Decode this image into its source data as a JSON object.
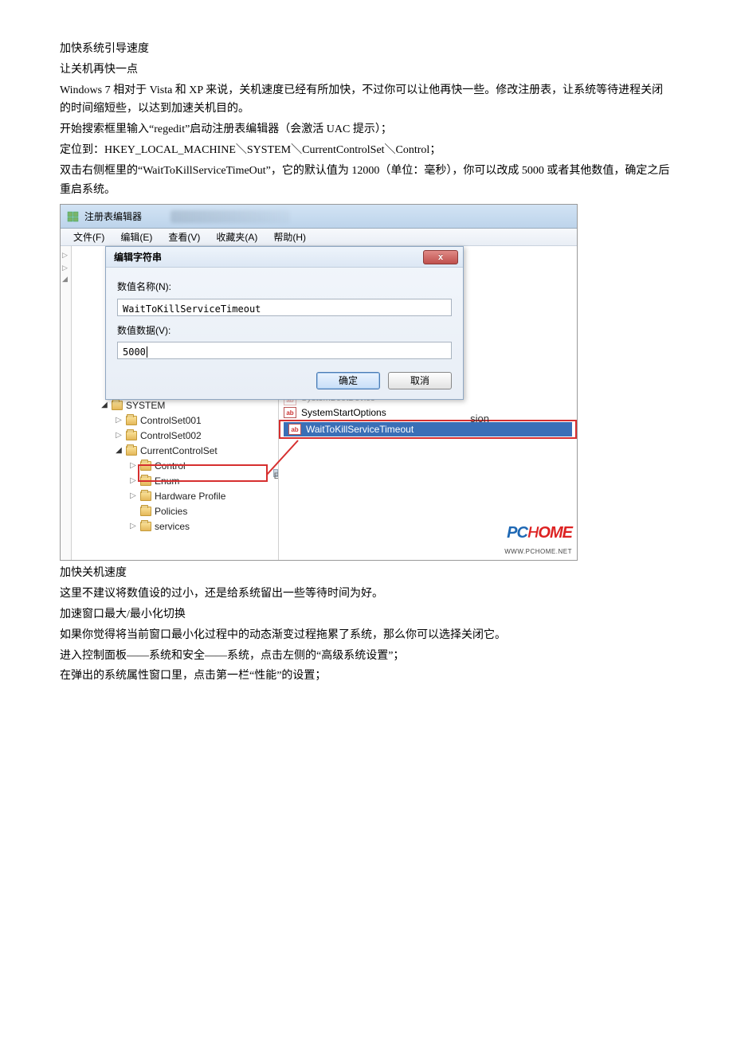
{
  "article": {
    "p1": "加快系统引导速度",
    "p2": "让关机再快一点",
    "p3": "Windows 7 相对于 Vista 和 XP 来说，关机速度已经有所加快，不过你可以让他再快一些。修改注册表，让系统等待进程关闭的时间缩短些，以达到加速关机目的。",
    "p4": "开始搜索框里输入“regedit”启动注册表编辑器（会激活 UAC 提示）；",
    "p5": "定位到：HKEY_LOCAL_MACHINE＼SYSTEM＼CurrentControlSet＼Control；",
    "p6": "双击右侧框里的“WaitToKillServiceTimeOut”，它的默认值为 12000（单位：毫秒），你可以改成 5000 或者其他数值，确定之后重启系统。",
    "p7": "加快关机速度",
    "p8": "这里不建议将数值设的过小，还是给系统留出一些等待时间为好。",
    "p9": "加速窗口最大/最小化切换",
    "p10": "如果你觉得将当前窗口最小化过程中的动态渐变过程拖累了系统，那么你可以选择关闭它。",
    "p11": "进入控制面板——系统和安全——系统，点击左侧的“高级系统设置”；",
    "p12": "在弹出的系统属性窗口里，点击第一栏“性能”的设置；"
  },
  "regedit": {
    "window_title": "注册表编辑器",
    "menu": {
      "file": "文件(F)",
      "edit": "编辑(E)",
      "view": "查看(V)",
      "fav": "收藏夹(A)",
      "help": "帮助(H)"
    },
    "dialog": {
      "title": "编辑字符串",
      "close_label": "x",
      "name_label": "数值名称(N):",
      "name_value": "WaitToKillServiceTimeout",
      "data_label": "数值数据(V):",
      "data_value": "5000",
      "ok": "确定",
      "cancel": "取消"
    },
    "tree": {
      "n0": "SYSTEM",
      "n1": "ControlSet001",
      "n2": "ControlSet002",
      "n3": "CurrentControlSet",
      "n4": "Control",
      "n5": "Enum",
      "n6": "Hardware Profile",
      "n7": "Policies",
      "n8": "services"
    },
    "values": {
      "partial": "SystemBootDevice",
      "v1": "SystemStartOptions",
      "v2": "WaitToKillServiceTimeout"
    },
    "clipped_text": "sion",
    "watermark": {
      "url": "WWW.PCHOME.NET"
    }
  }
}
